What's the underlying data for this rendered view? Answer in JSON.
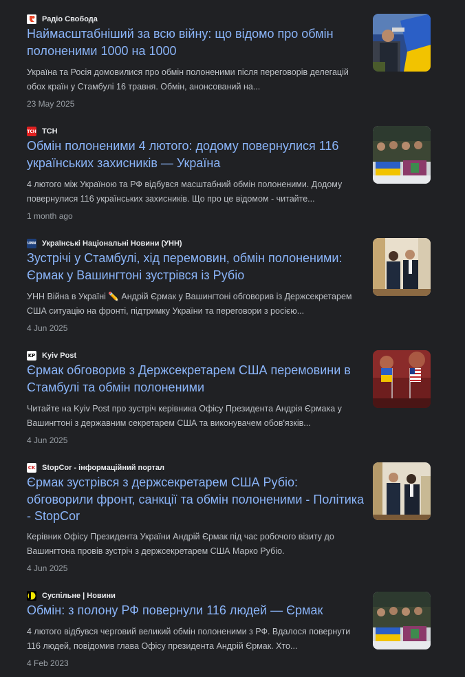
{
  "results": [
    {
      "source": "Радіо Свобода",
      "favicon_icon": "radio-svoboda-logo-icon",
      "title": "Наймасштабніший за всю війну: що відомо про обмін полоненими 1000 на 1000",
      "snippet": "Україна та Росія домовилися про обмін полоненими після переговорів делегацій обох країн у Стамбулі 16 травня. Обмін, анонсований на...",
      "date": "23 May 2025",
      "thumbnail_icon": "prisoner-exchange-flag-photo"
    },
    {
      "source": "ТСН",
      "favicon_icon": "tsn-logo-icon",
      "favicon_text": "ТСН",
      "title": "Обмін полоненими 4 лютого: додому повернулися 116 українських захисників — Україна",
      "snippet": "4 лютого між Україною та РФ відбувся масштабний обмін полоненими. Додому повернулися 116 українських захисників. Що про це відомом - читайте...",
      "date": "1 month ago",
      "thumbnail_icon": "soldiers-group-photo"
    },
    {
      "source": "Українські Національні Новини (УНН)",
      "favicon_icon": "unn-logo-icon",
      "favicon_text": "UNN",
      "title": "Зустрічі у Стамбулі, хід перемовин, обмін полоненими: Єрмак у Вашингтоні зустрівся із Рубіо",
      "snippet": "УНН Війна в Україні ✏️ Андрій Єрмак у Вашингтоні обговорив із Держсекретарем США ситуацію на фронті, підтримку України та переговори з росією...",
      "date": "4 Jun 2025",
      "thumbnail_icon": "officials-meeting-photo"
    },
    {
      "source": "Kyiv Post",
      "favicon_icon": "kyiv-post-logo-icon",
      "favicon_text": "KP",
      "title": "Єрмак обговорив з Держсекретарем США перемовини в Стамбулі та обмін полоненими",
      "snippet": "Читайте на Kyiv Post про зустріч керівника Офісу Президента Андрія Єрмака у Вашингтоні з державним секретарем США та виконувачем обов'язків...",
      "date": "4 Jun 2025",
      "thumbnail_icon": "flags-table-photo"
    },
    {
      "source": "StopCor - інформаційний портал",
      "favicon_icon": "stopcor-logo-icon",
      "favicon_text": "CK",
      "title": "Єрмак зустрівся з держсекретарем США Рубіо: обговорили фронт, санкції та обмін полоненими - Політика - StopCor",
      "snippet": "Керівник Офісу Президента України Андрій Єрмак під час робочого візиту до Вашингтона провів зустріч з держсекретарем США Марко Рубіо.",
      "date": "4 Jun 2025",
      "thumbnail_icon": "officials-meeting-photo"
    },
    {
      "source": "Суспільне | Новини",
      "favicon_icon": "suspilne-logo-icon",
      "title": "Обмін: з полону РФ повернули 116 людей — Єрмак",
      "snippet": "4 лютого відбувся черговий великий обмін полоненими з РФ. Вдалося повернути 116 людей, повідомив глава Офісу президента Андрій Єрмак. Хто...",
      "date": "4 Feb 2023",
      "thumbnail_icon": "soldiers-group-photo"
    }
  ]
}
